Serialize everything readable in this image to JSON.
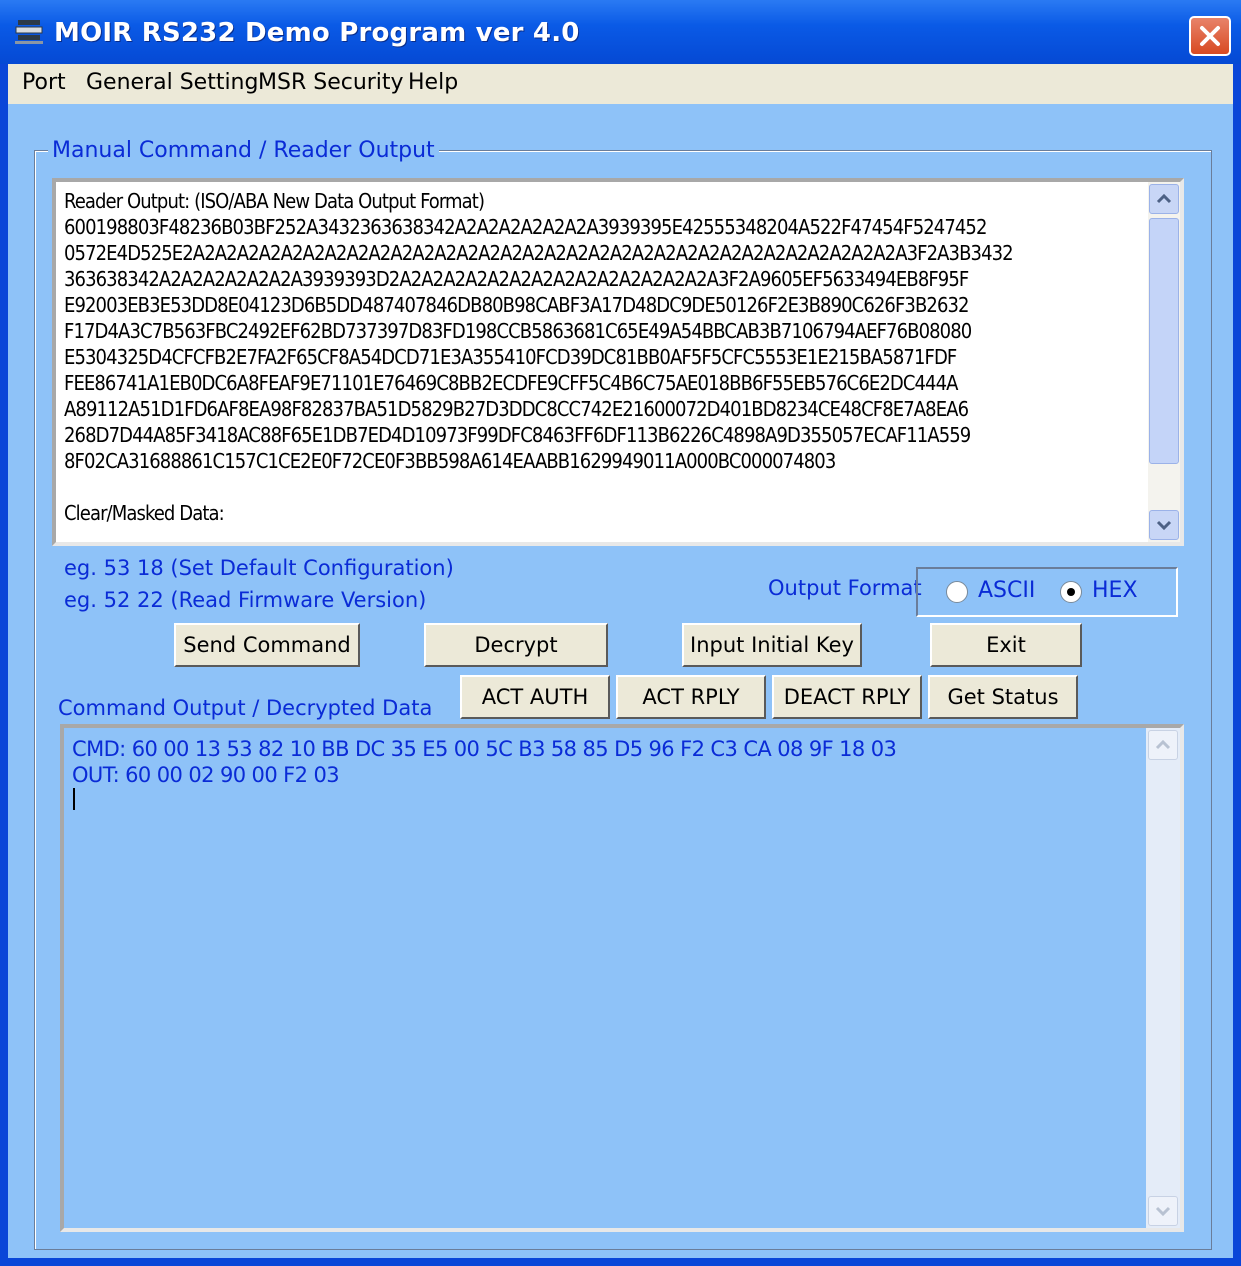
{
  "window": {
    "title": "MOIR RS232 Demo Program ver 4.0"
  },
  "menu": {
    "items": [
      "Port",
      "General Setting",
      "MSR Security",
      "Help"
    ]
  },
  "group": {
    "label": "Manual Command / Reader Output"
  },
  "reader": {
    "text": "Reader Output: (ISO/ABA New Data Output Format)\n600198803F48236B03BF252A3432363638342A2A2A2A2A2A2A3939395E42555348204A522F47454F5247452\n0572E4D525E2A2A2A2A2A2A2A2A2A2A2A2A2A2A2A2A2A2A2A2A2A2A2A2A2A2A2A2A2A2A2A2A2A3F2A3B3432\n363638342A2A2A2A2A2A2A3939393D2A2A2A2A2A2A2A2A2A2A2A2A2A2A2A3F2A9605EF5633494EB8F95F\nE92003EB3E53DD8E04123D6B5DD487407846DB80B98CABF3A17D48DC9DE50126F2E3B890C626F3B2632\nF17D4A3C7B563FBC2492EF62BD737397D83FD198CCB5863681C65E49A54BBCAB3B7106794AEF76B08080\nE5304325D4CFCFB2E7FA2F65CF8A54DCD71E3A355410FCD39DC81BB0AF5F5CFC5553E1E215BA5871FDF\nFEE86741A1EB0DC6A8FEAF9E71101E76469C8BB2ECDFE9CFF5C4B6C75AE018BB6F55EB576C6E2DC444A\nA89112A51D1FD6AF8EA98F82837BA51D5829B27D3DDC8CC742E21600072D401BD8234CE48CF8E7A8EA6\n268D7D44A85F3418AC88F65E1DB7ED4D10973F99DFC8463FF6DF113B6226C4898A9D355057ECAF11A559\n8F02CA31688861C157C1CE2E0F72CE0F3BB598A614EAABB1629949011A000BC000074803\n\nClear/Masked Data:"
  },
  "hints": {
    "hint1": "eg. 53 18 (Set Default Configuration)",
    "hint2": "eg. 52 22 (Read Firmware Version)"
  },
  "output_format": {
    "label": "Output Format",
    "options": [
      "ASCII",
      "HEX"
    ],
    "selected": "HEX"
  },
  "buttons": {
    "send": "Send Command",
    "decrypt": "Decrypt",
    "input_key": "Input Initial Key",
    "exit": "Exit",
    "act_auth": "ACT AUTH",
    "act_rply": "ACT RPLY",
    "deact_rply": "DEACT RPLY",
    "get_status": "Get Status"
  },
  "command_output": {
    "label": "Command Output / Decrypted Data",
    "text": "CMD: 60 00 13 53 82 10 BB DC 35 E5 00 5C B3 58 85 D5 96 F2 C3 CA 08 9F 18 03\nOUT: 60 00 02 90 00 F2 03"
  },
  "colors": {
    "titlebar": "#0a5ae6",
    "client_bg": "#8ec2f8",
    "label_text": "#0a2bd6",
    "close_button": "#d84a22"
  }
}
